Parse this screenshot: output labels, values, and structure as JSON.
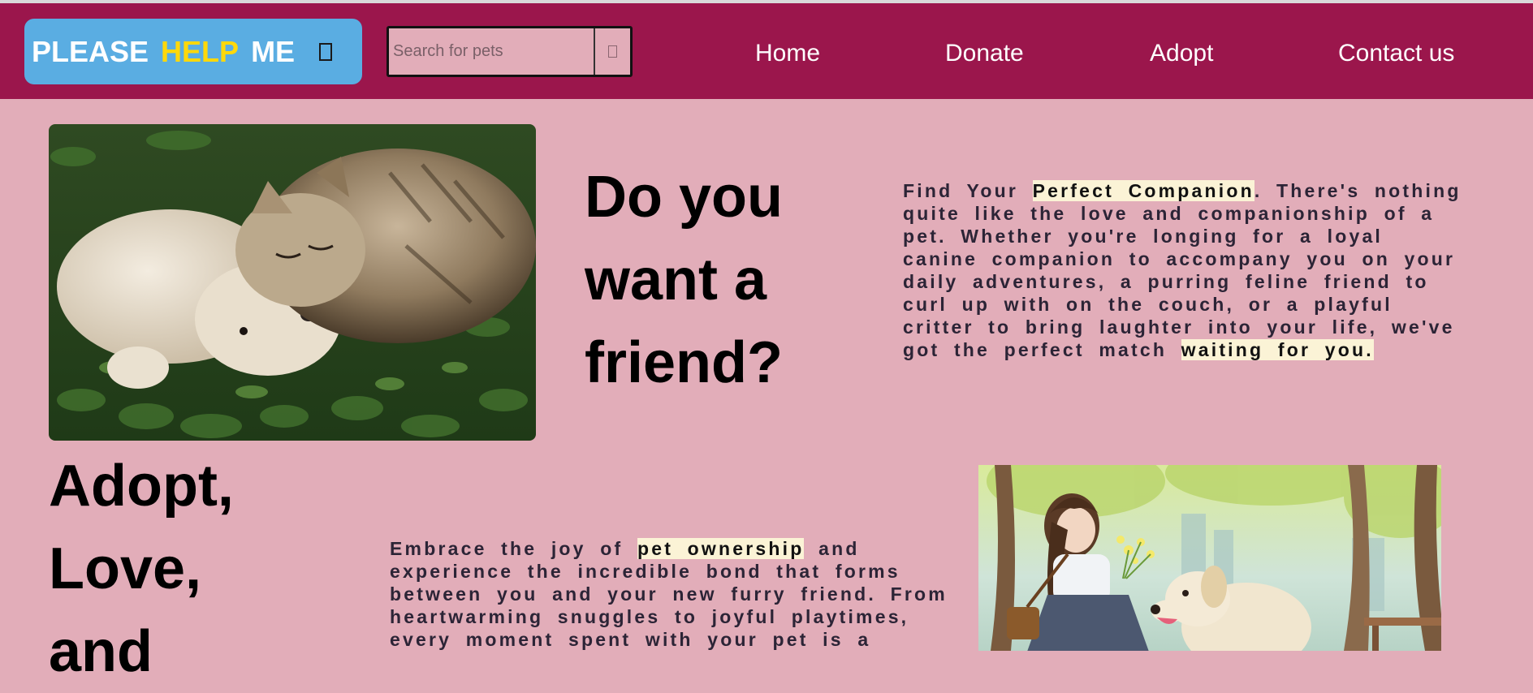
{
  "header": {
    "logo": {
      "word1": "PLEASE",
      "word2": "HELP",
      "word3": "ME",
      "icon": "paw-icon"
    },
    "search": {
      "placeholder": "Search for pets",
      "button_icon": "search-icon"
    },
    "nav": [
      {
        "label": "Home"
      },
      {
        "label": "Donate"
      },
      {
        "label": "Adopt"
      },
      {
        "label": "Contact us"
      }
    ]
  },
  "hero": {
    "heading_lines": [
      "Do you",
      "want a",
      "friend?"
    ],
    "paragraph_lines": [
      [
        "Find Your ",
        "Perfect Companion",
        ". There's nothing"
      ],
      [
        "quite like the love and companionship of a"
      ],
      [
        "pet. Whether you're longing for a loyal"
      ],
      [
        "canine companion to accompany you on your"
      ],
      [
        "daily adventures, a purring feline friend to"
      ],
      [
        "curl up with on the couch, or a playful"
      ],
      [
        "critter to bring laughter into your life, we've"
      ],
      [
        "got the perfect match ",
        "waiting for you."
      ]
    ]
  },
  "second": {
    "heading_lines": [
      "Adopt,",
      "Love,",
      "and"
    ],
    "paragraph_lines": [
      [
        "Embrace the joy of ",
        "pet ownership",
        " and"
      ],
      [
        "experience the incredible bond that forms"
      ],
      [
        "between you and your new furry friend. From"
      ],
      [
        "heartwarming snuggles to joyful playtimes,"
      ],
      [
        "every moment spent with your pet is a"
      ]
    ]
  },
  "colors": {
    "header_bg": "#9b164c",
    "page_bg": "#e2adb9",
    "logo_bg": "#5aade2",
    "logo_accent": "#ffd80a",
    "highlight": "#fbf3d6"
  }
}
